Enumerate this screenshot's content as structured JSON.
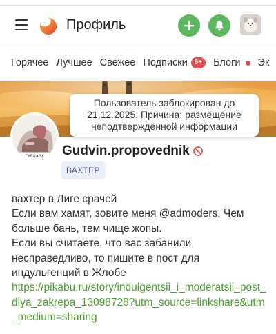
{
  "header": {
    "title": "Профиль",
    "menu_icon": "hamburger-icon",
    "add_icon": "plus-icon",
    "bell_icon": "bell-icon"
  },
  "nav": {
    "items": [
      {
        "label": "Горячее"
      },
      {
        "label": "Лучшее"
      },
      {
        "label": "Свежее"
      },
      {
        "label": "Подписки",
        "badge": "9+"
      },
      {
        "label": "Блоги"
      },
      {
        "label": "Эк"
      }
    ]
  },
  "tooltip": {
    "line1": "Пользователь заблокирован до",
    "line2": "21.12.2025. Причина: размещение",
    "line3": "неподтверждённой информации"
  },
  "profile": {
    "username": "Gudvin.propovednik",
    "role": "ВАХТЕР",
    "avatar_caption": "ГУРИАРХ"
  },
  "bio": {
    "line1": "вахтер в Лиге срачей",
    "line2": "Если вам хамят, зовите меня @admoders. Чем больше бань, тем чище жопы.",
    "line3": "Если вы считаете, что вас забанили несправедливо, то пишите в пост для индульгенций в Жлобе",
    "link": "https://pikabu.ru/story/indulgentsii_i_moderatsii_post_dlya_zakrepa_13098728?utm_source=linkshare&utm_medium=sharing"
  },
  "colors": {
    "accent_green": "#5cb85c",
    "badge_red": "#e84a4a",
    "link_green": "#4aa02c",
    "role_bg": "#e9eef9"
  }
}
